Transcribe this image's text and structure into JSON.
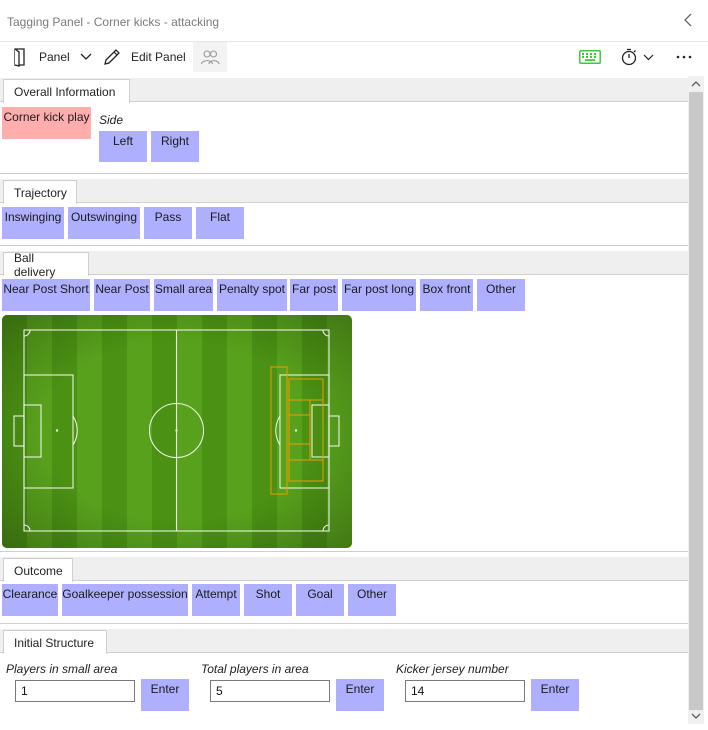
{
  "window": {
    "title": "Tagging Panel - Corner kicks - attacking"
  },
  "toolbar": {
    "panel_label": "Panel",
    "edit_panel_label": "Edit Panel"
  },
  "sections": {
    "overall": {
      "tab": "Overall Information",
      "corner_kick_play": "Corner kick play",
      "side_label": "Side",
      "left": "Left",
      "right": "Right"
    },
    "trajectory": {
      "tab": "Trajectory",
      "items": [
        "Inswinging",
        "Outswinging",
        "Pass",
        "Flat"
      ]
    },
    "ball_delivery": {
      "tab": "Ball delivery",
      "items": [
        "Near Post Short",
        "Near Post",
        "Small area",
        "Penalty spot",
        "Far post",
        "Far post long",
        "Box front",
        "Other"
      ]
    },
    "outcome": {
      "tab": "Outcome",
      "items": [
        "Clearance",
        "Goalkeeper possession",
        "Attempt",
        "Shot",
        "Goal",
        "Other"
      ]
    },
    "initial_structure": {
      "tab": "Initial Structure",
      "fields": [
        {
          "label": "Players in small area",
          "value": "1",
          "button": "Enter"
        },
        {
          "label": "Total players in area",
          "value": "5",
          "button": "Enter"
        },
        {
          "label": "Kicker jersey number",
          "value": "14",
          "button": "Enter"
        }
      ]
    }
  },
  "colors": {
    "tag_blue": "#aeb0ff",
    "tag_pink": "#ffadad",
    "pitch_green_light": "#5aa21e",
    "pitch_green_dark": "#4a8f14",
    "zone_orange": "#e8a000",
    "keyboard_green": "#3cc93c"
  },
  "icons": {
    "collapse": "chevron-left-icon",
    "panel": "panel-icon",
    "panel_dropdown": "chevron-down-icon",
    "edit_panel": "pencil-icon",
    "people": "people-icon",
    "keyboard": "keyboard-icon",
    "timer": "stopwatch-icon",
    "more": "more-icon"
  }
}
